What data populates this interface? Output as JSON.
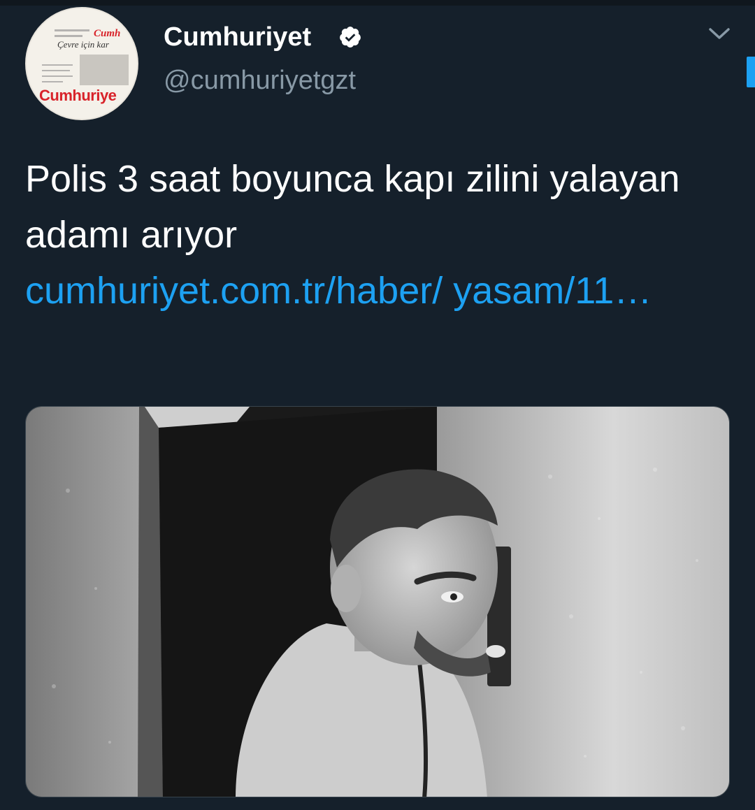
{
  "tweet": {
    "author_name": "Cumhuriyet",
    "author_handle": "@cumhuriyetgzt",
    "verified": true,
    "text": "Polis 3 saat boyunca kapı zilini yalayan adamı arıyor",
    "link_text": "cumhuriyet.com.tr/haber/ yasam/11…"
  },
  "avatar": {
    "masthead": "Cumh",
    "headline": "Çevre için kar",
    "logo": "Cumhuriye"
  },
  "icons": {
    "verified": "verified-badge-icon",
    "menu": "chevron-down-icon"
  },
  "colors": {
    "background": "#15202b",
    "link": "#1da1f2",
    "secondary_text": "#8899a6",
    "brand_red": "#d8232a"
  }
}
